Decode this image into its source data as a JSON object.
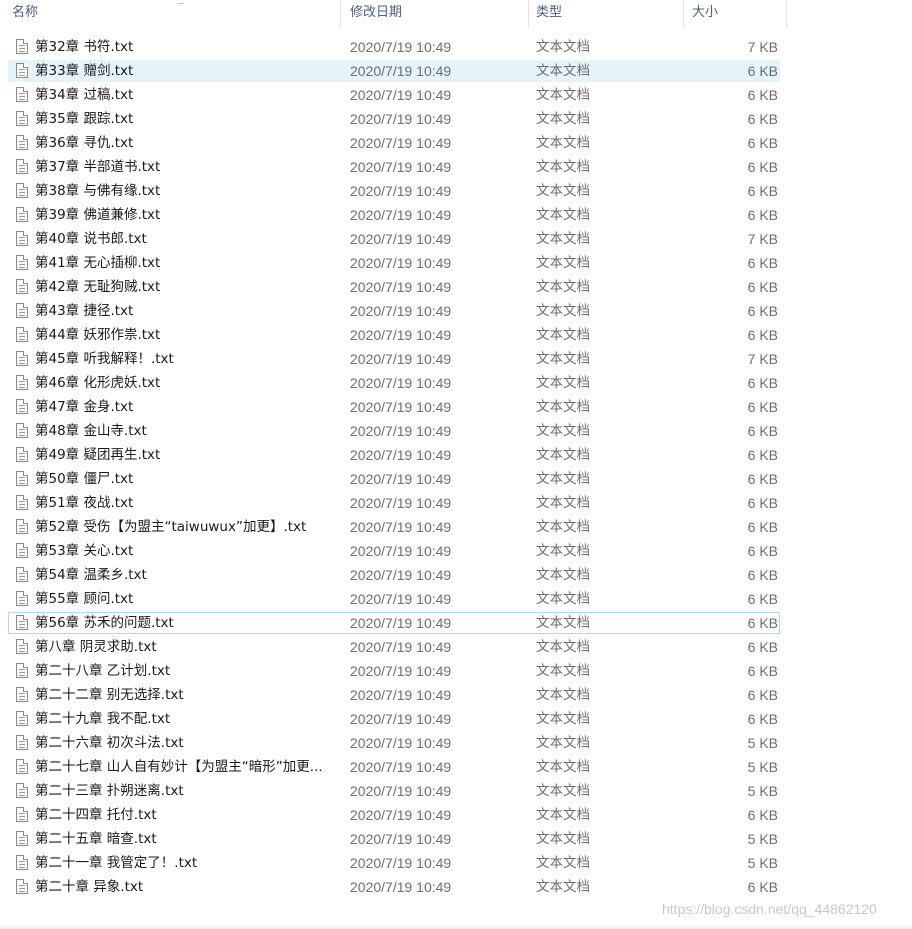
{
  "columns": {
    "name": "名称",
    "date": "修改日期",
    "type": "类型",
    "size": "大小"
  },
  "icons": {
    "file": "text-file-icon"
  },
  "colors": {
    "selected_bg": "#e5f3fb",
    "focus_border": "#b8d6e8",
    "header_text": "#4c607a"
  },
  "files": [
    {
      "name": "第32章 书符.txt",
      "date": "2020/7/19 10:49",
      "type": "文本文档",
      "size": "7 KB"
    },
    {
      "name": "第33章 赠剑.txt",
      "date": "2020/7/19 10:49",
      "type": "文本文档",
      "size": "6 KB",
      "selected": true
    },
    {
      "name": "第34章 过稿.txt",
      "date": "2020/7/19 10:49",
      "type": "文本文档",
      "size": "6 KB"
    },
    {
      "name": "第35章 跟踪.txt",
      "date": "2020/7/19 10:49",
      "type": "文本文档",
      "size": "6 KB"
    },
    {
      "name": "第36章 寻仇.txt",
      "date": "2020/7/19 10:49",
      "type": "文本文档",
      "size": "6 KB"
    },
    {
      "name": "第37章 半部道书.txt",
      "date": "2020/7/19 10:49",
      "type": "文本文档",
      "size": "6 KB"
    },
    {
      "name": "第38章 与佛有缘.txt",
      "date": "2020/7/19 10:49",
      "type": "文本文档",
      "size": "6 KB"
    },
    {
      "name": "第39章 佛道兼修.txt",
      "date": "2020/7/19 10:49",
      "type": "文本文档",
      "size": "6 KB"
    },
    {
      "name": "第40章 说书郎.txt",
      "date": "2020/7/19 10:49",
      "type": "文本文档",
      "size": "7 KB"
    },
    {
      "name": "第41章 无心插柳.txt",
      "date": "2020/7/19 10:49",
      "type": "文本文档",
      "size": "6 KB"
    },
    {
      "name": "第42章 无耻狗贼.txt",
      "date": "2020/7/19 10:49",
      "type": "文本文档",
      "size": "6 KB"
    },
    {
      "name": "第43章 捷径.txt",
      "date": "2020/7/19 10:49",
      "type": "文本文档",
      "size": "6 KB"
    },
    {
      "name": "第44章 妖邪作祟.txt",
      "date": "2020/7/19 10:49",
      "type": "文本文档",
      "size": "6 KB"
    },
    {
      "name": "第45章 听我解释！.txt",
      "date": "2020/7/19 10:49",
      "type": "文本文档",
      "size": "7 KB"
    },
    {
      "name": "第46章 化形虎妖.txt",
      "date": "2020/7/19 10:49",
      "type": "文本文档",
      "size": "6 KB"
    },
    {
      "name": "第47章 金身.txt",
      "date": "2020/7/19 10:49",
      "type": "文本文档",
      "size": "6 KB"
    },
    {
      "name": "第48章 金山寺.txt",
      "date": "2020/7/19 10:49",
      "type": "文本文档",
      "size": "6 KB"
    },
    {
      "name": "第49章 疑团再生.txt",
      "date": "2020/7/19 10:49",
      "type": "文本文档",
      "size": "6 KB"
    },
    {
      "name": "第50章 僵尸.txt",
      "date": "2020/7/19 10:49",
      "type": "文本文档",
      "size": "6 KB"
    },
    {
      "name": "第51章 夜战.txt",
      "date": "2020/7/19 10:49",
      "type": "文本文档",
      "size": "6 KB"
    },
    {
      "name": "第52章 受伤【为盟主“taiwuwux”加更】.txt",
      "date": "2020/7/19 10:49",
      "type": "文本文档",
      "size": "6 KB"
    },
    {
      "name": "第53章 关心.txt",
      "date": "2020/7/19 10:49",
      "type": "文本文档",
      "size": "6 KB"
    },
    {
      "name": "第54章 温柔乡.txt",
      "date": "2020/7/19 10:49",
      "type": "文本文档",
      "size": "6 KB"
    },
    {
      "name": "第55章 顾问.txt",
      "date": "2020/7/19 10:49",
      "type": "文本文档",
      "size": "6 KB"
    },
    {
      "name": "第56章 苏禾的问题.txt",
      "date": "2020/7/19 10:49",
      "type": "文本文档",
      "size": "6 KB",
      "focused": true
    },
    {
      "name": "第八章 阴灵求助.txt",
      "date": "2020/7/19 10:49",
      "type": "文本文档",
      "size": "6 KB"
    },
    {
      "name": "第二十八章 乙计划.txt",
      "date": "2020/7/19 10:49",
      "type": "文本文档",
      "size": "6 KB"
    },
    {
      "name": "第二十二章 别无选择.txt",
      "date": "2020/7/19 10:49",
      "type": "文本文档",
      "size": "6 KB"
    },
    {
      "name": "第二十九章 我不配.txt",
      "date": "2020/7/19 10:49",
      "type": "文本文档",
      "size": "6 KB"
    },
    {
      "name": "第二十六章 初次斗法.txt",
      "date": "2020/7/19 10:49",
      "type": "文本文档",
      "size": "5 KB"
    },
    {
      "name": "第二十七章 山人自有妙计【为盟主“暗形”加更...",
      "date": "2020/7/19 10:49",
      "type": "文本文档",
      "size": "5 KB"
    },
    {
      "name": "第二十三章 扑朔迷离.txt",
      "date": "2020/7/19 10:49",
      "type": "文本文档",
      "size": "5 KB"
    },
    {
      "name": "第二十四章 托付.txt",
      "date": "2020/7/19 10:49",
      "type": "文本文档",
      "size": "6 KB"
    },
    {
      "name": "第二十五章 暗查.txt",
      "date": "2020/7/19 10:49",
      "type": "文本文档",
      "size": "5 KB"
    },
    {
      "name": "第二十一章 我管定了！.txt",
      "date": "2020/7/19 10:49",
      "type": "文本文档",
      "size": "5 KB"
    },
    {
      "name": "第二十章 异象.txt",
      "date": "2020/7/19 10:49",
      "type": "文本文档",
      "size": "6 KB"
    }
  ],
  "watermark": "https://blog.csdn.net/qq_44862120"
}
